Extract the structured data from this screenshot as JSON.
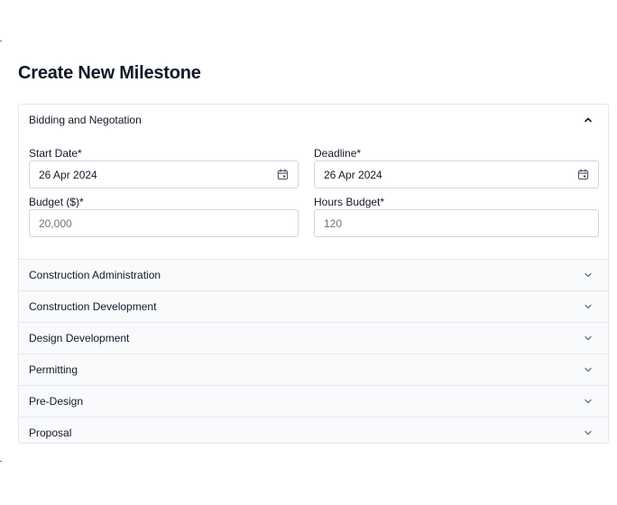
{
  "page": {
    "title": "Create New Milestone"
  },
  "accordion": {
    "open_panel": {
      "title": "Bidding and Negotation",
      "fields": {
        "start_date": {
          "label": "Start Date*",
          "value": "26 Apr 2024"
        },
        "deadline": {
          "label": "Deadline*",
          "value": "26 Apr 2024"
        },
        "budget": {
          "label": "Budget ($)*",
          "placeholder": "20,000"
        },
        "hours_budget": {
          "label": "Hours Budget*",
          "placeholder": "120"
        }
      }
    },
    "collapsed_panels": [
      {
        "title": "Construction Administration"
      },
      {
        "title": "Construction Development"
      },
      {
        "title": "Design Development"
      },
      {
        "title": "Permitting"
      },
      {
        "title": "Pre-Design"
      },
      {
        "title": "Proposal"
      }
    ]
  },
  "icons": {
    "open_chevron": "chevron-up-icon",
    "collapsed_chevron": "chevron-down-icon",
    "date_picker": "calendar-icon"
  },
  "colors": {
    "border": "#e5e7eb",
    "input_border": "#d1d5db",
    "collapsed_bg": "#f9fafb",
    "text": "#111827",
    "placeholder": "#6b7280"
  }
}
